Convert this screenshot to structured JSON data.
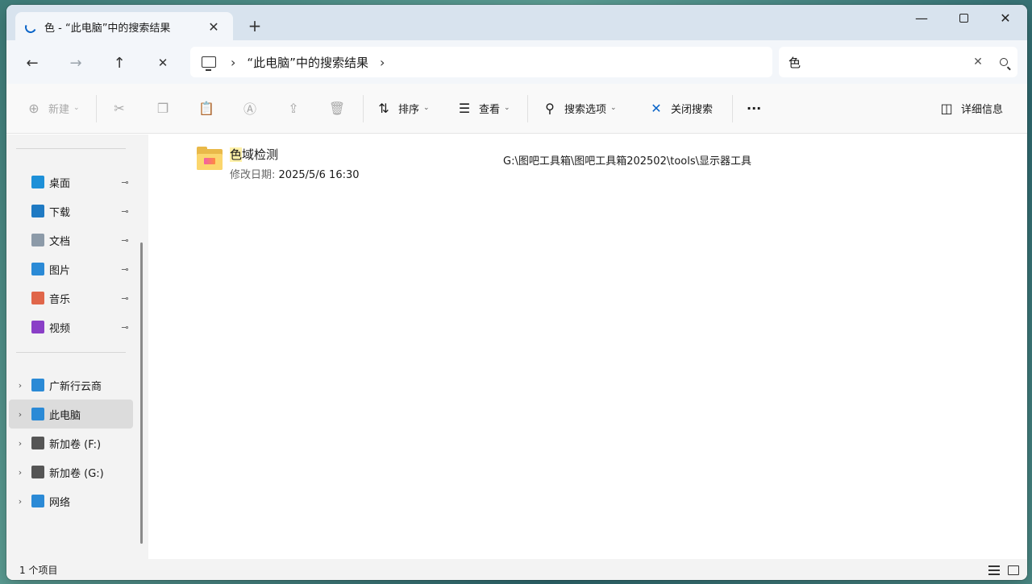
{
  "window": {
    "tab_title": "色 - “此电脑”中的搜索结果",
    "tab_close": "✕",
    "new_tab": "+",
    "minimize": "—",
    "close": "✕"
  },
  "nav": {
    "back": "←",
    "forward": "→",
    "up": "↑",
    "stop": "✕",
    "separator": "›",
    "breadcrumb": "“此电脑”中的搜索结果",
    "breadcrumb_chevron": "›"
  },
  "search": {
    "query": "色",
    "clear": "✕"
  },
  "toolbar": {
    "new_label": "新建",
    "sort_label": "排序",
    "view_label": "查看",
    "search_options_label": "搜索选项",
    "close_search_label": "关闭搜索",
    "more_label": "···",
    "details_label": "详细信息",
    "icons": {
      "new": "plus-circle-icon",
      "cut": "scissors-icon",
      "copy": "copy-icon",
      "paste": "paste-icon",
      "rename": "rename-icon",
      "share": "share-icon",
      "delete": "trash-icon"
    }
  },
  "sidebar": {
    "quick_access": [
      {
        "label": "桌面",
        "icon": "desktop-icon",
        "color": "#1e90d8"
      },
      {
        "label": "下载",
        "icon": "download-icon",
        "color": "#1f7ac3"
      },
      {
        "label": "文档",
        "icon": "document-icon",
        "color": "#8c9aa8"
      },
      {
        "label": "图片",
        "icon": "pictures-icon",
        "color": "#2b8ad6"
      },
      {
        "label": "音乐",
        "icon": "music-icon",
        "color": "#e0664a"
      },
      {
        "label": "视频",
        "icon": "video-icon",
        "color": "#8a3fc7"
      }
    ],
    "locations": [
      {
        "label": "广新行云商",
        "icon": "cloud-drive-icon",
        "color": "#2b8ad6"
      },
      {
        "label": "此电脑",
        "icon": "this-pc-icon",
        "color": "#2b8ad6"
      },
      {
        "label": "新加卷 (F:)",
        "icon": "drive-icon",
        "color": "#555555"
      },
      {
        "label": "新加卷 (G:)",
        "icon": "drive-icon",
        "color": "#555555"
      },
      {
        "label": "网络",
        "icon": "network-icon",
        "color": "#2b8ad6"
      }
    ],
    "pin": "📌",
    "chevron": "›"
  },
  "results": [
    {
      "name_highlight": "色",
      "name_rest": "域检测",
      "modified_label": "修改日期:",
      "modified_value": "2025/5/6 16:30",
      "path": "G:\\图吧工具箱\\图吧工具箱202502\\tools\\显示器工具"
    }
  ],
  "status": {
    "item_count": "1 个项目"
  }
}
